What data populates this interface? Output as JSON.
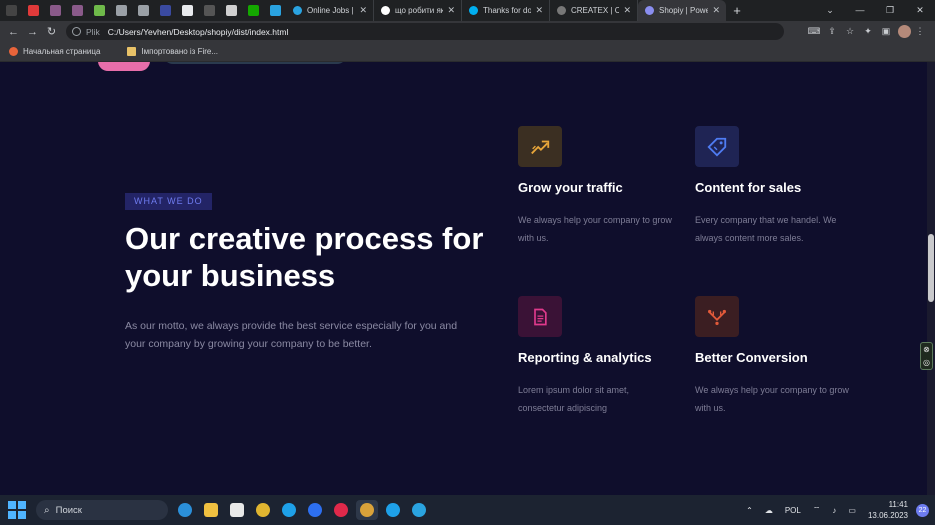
{
  "browser": {
    "pinned_tabs": [
      {
        "name": "m-tab",
        "color": "#444"
      },
      {
        "name": "youtube-tab",
        "color": "#e03a3a"
      },
      {
        "name": "book-tab-1",
        "color": "#8a5a8a"
      },
      {
        "name": "book-tab-2",
        "color": "#8a5a8a"
      },
      {
        "name": "upwork-shield-tab",
        "color": "#6fba4a"
      },
      {
        "name": "globe-tab-1",
        "color": "#9aa0a6"
      },
      {
        "name": "globe-tab-2",
        "color": "#9aa0a6"
      },
      {
        "name": "triangle-tab",
        "color": "#3a4aa0"
      },
      {
        "name": "w3-tab",
        "color": "#e8eaed"
      },
      {
        "name": "terminal-tab",
        "color": "#555"
      },
      {
        "name": "settings-tab",
        "color": "#d0d0d0"
      },
      {
        "name": "upwork-tab",
        "color": "#14a800"
      },
      {
        "name": "telegram-tab",
        "color": "#2aa3e0"
      }
    ],
    "tabs": [
      {
        "title": "Online Jobs | F",
        "color": "#2aa3e0",
        "active": false
      },
      {
        "title": "що робити як",
        "color": "#ffffff",
        "active": false
      },
      {
        "title": "Thanks for do",
        "color": "#00aff0",
        "active": false
      },
      {
        "title": "CREATEX | Cou",
        "color": "#777",
        "active": false
      },
      {
        "title": "Shopiy | Powe",
        "color": "#8a8ef0",
        "active": true
      }
    ],
    "new_tab_label": "+",
    "address": {
      "scheme": "Plik",
      "url": "C:/Users/Yevhen/Desktop/shopiy/dist/index.html"
    },
    "bookmarks": [
      {
        "label": "Начальная страница",
        "type": "firefox"
      },
      {
        "label": "Імпортовано із Fire...",
        "type": "folder"
      }
    ]
  },
  "section": {
    "badge": "WHAT WE DO",
    "headline": "Our creative process for your business",
    "lead": "As our motto, we always provide the best service especially for you and your company by growing your company to be better."
  },
  "features": [
    {
      "title": "Grow your traffic",
      "desc": "We always help your company to grow with us.",
      "icon": "trending-up-icon",
      "bg": "#3b2f22",
      "fg": "#e8a63a"
    },
    {
      "title": "Content for sales",
      "desc": "Every company that we handel. We always content more sales.",
      "icon": "price-tag-icon",
      "bg": "#1f2454",
      "fg": "#4f7cf2"
    },
    {
      "title": "Reporting & analytics",
      "desc": "Lorem ipsum dolor sit amet, consectetur adipiscing",
      "icon": "document-icon",
      "bg": "#3a1236",
      "fg": "#e03a8c"
    },
    {
      "title": "Better Conversion",
      "desc": "We always help your company to grow with us.",
      "icon": "conversion-icon",
      "bg": "#3b1e22",
      "fg": "#e25a3a"
    }
  ],
  "taskbar": {
    "search_label": "Поиск",
    "language": "POL",
    "time": "11:41",
    "date": "13.06.2023",
    "notifications": "22"
  }
}
